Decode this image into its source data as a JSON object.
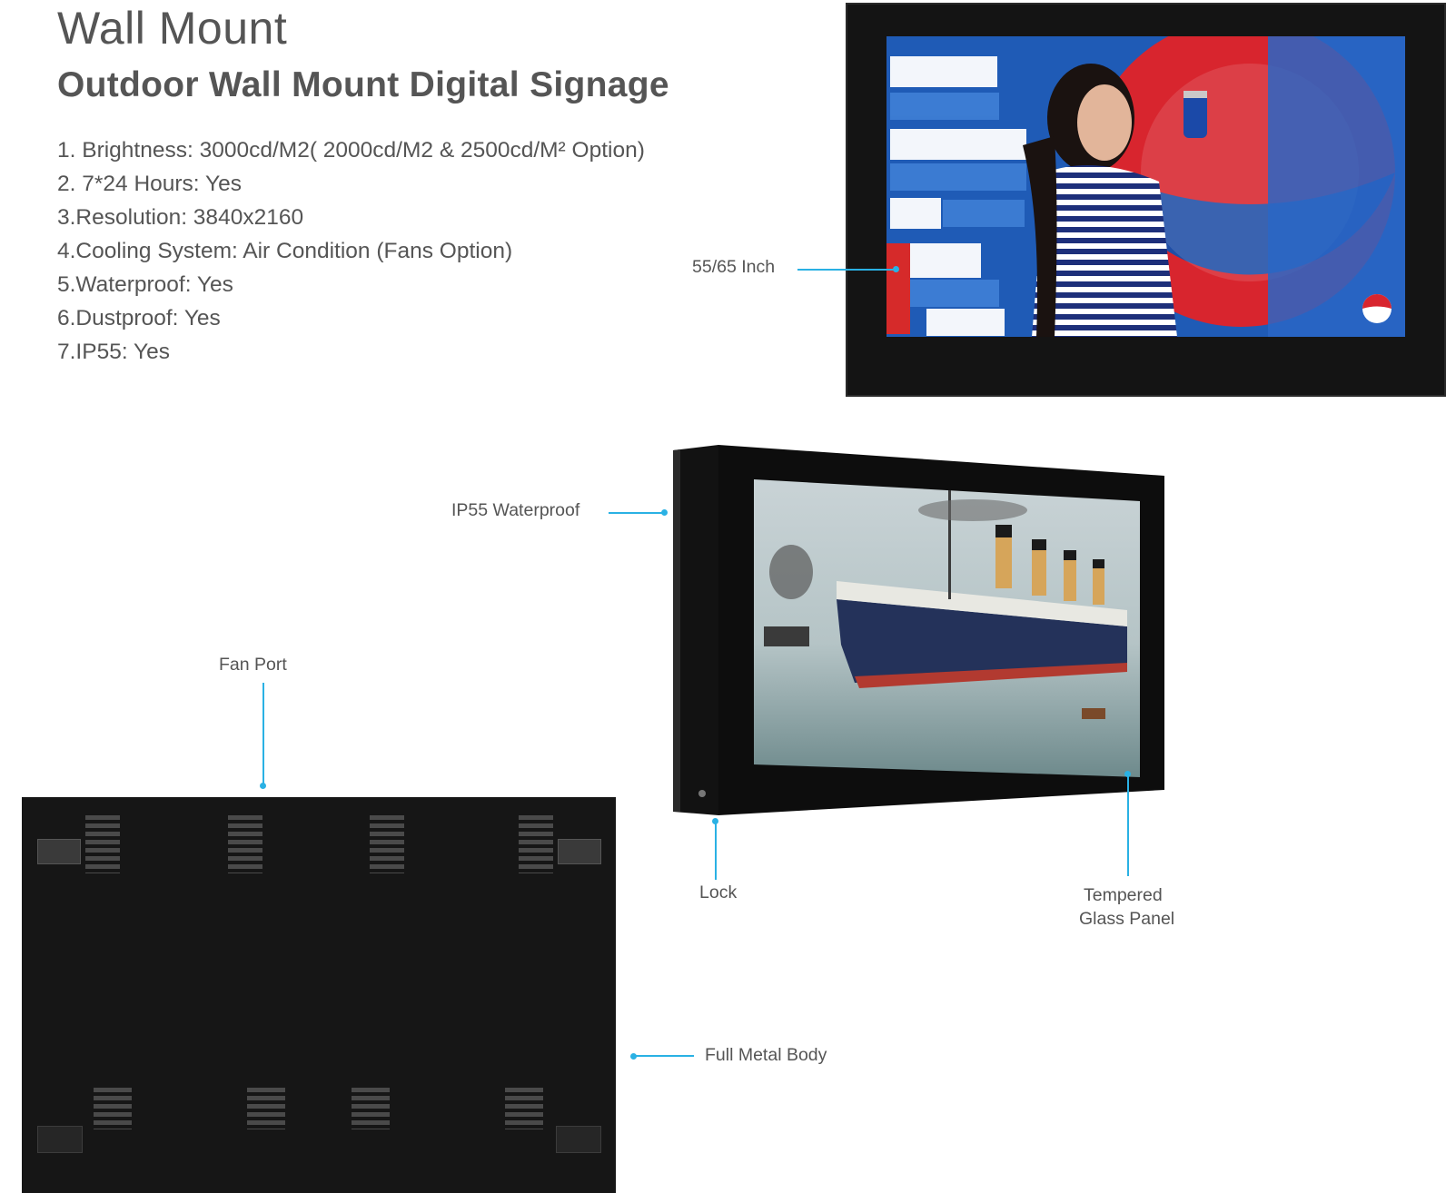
{
  "header": {
    "title": "Wall Mount",
    "subtitle": "Outdoor Wall Mount Digital Signage"
  },
  "specs": [
    "1. Brightness: 3000cd/M2( 2000cd/M2 & 2500cd/M² Option)",
    "2. 7*24 Hours: Yes",
    "3.Resolution: 3840x2160",
    "4.Cooling System: Air Condition (Fans Option)",
    "5.Waterproof: Yes",
    "6.Dustproof: Yes",
    "7.IP55: Yes"
  ],
  "callouts": {
    "size": "55/65 Inch",
    "waterproof": "IP55 Waterproof",
    "fan_port": "Fan Port",
    "lock": "Lock",
    "glass_line1": "Tempered",
    "glass_line2": "Glass Panel",
    "metal_body": "Full Metal Body"
  },
  "colors": {
    "accent": "#2ab1e4",
    "text": "#555555",
    "device": "#141414"
  }
}
